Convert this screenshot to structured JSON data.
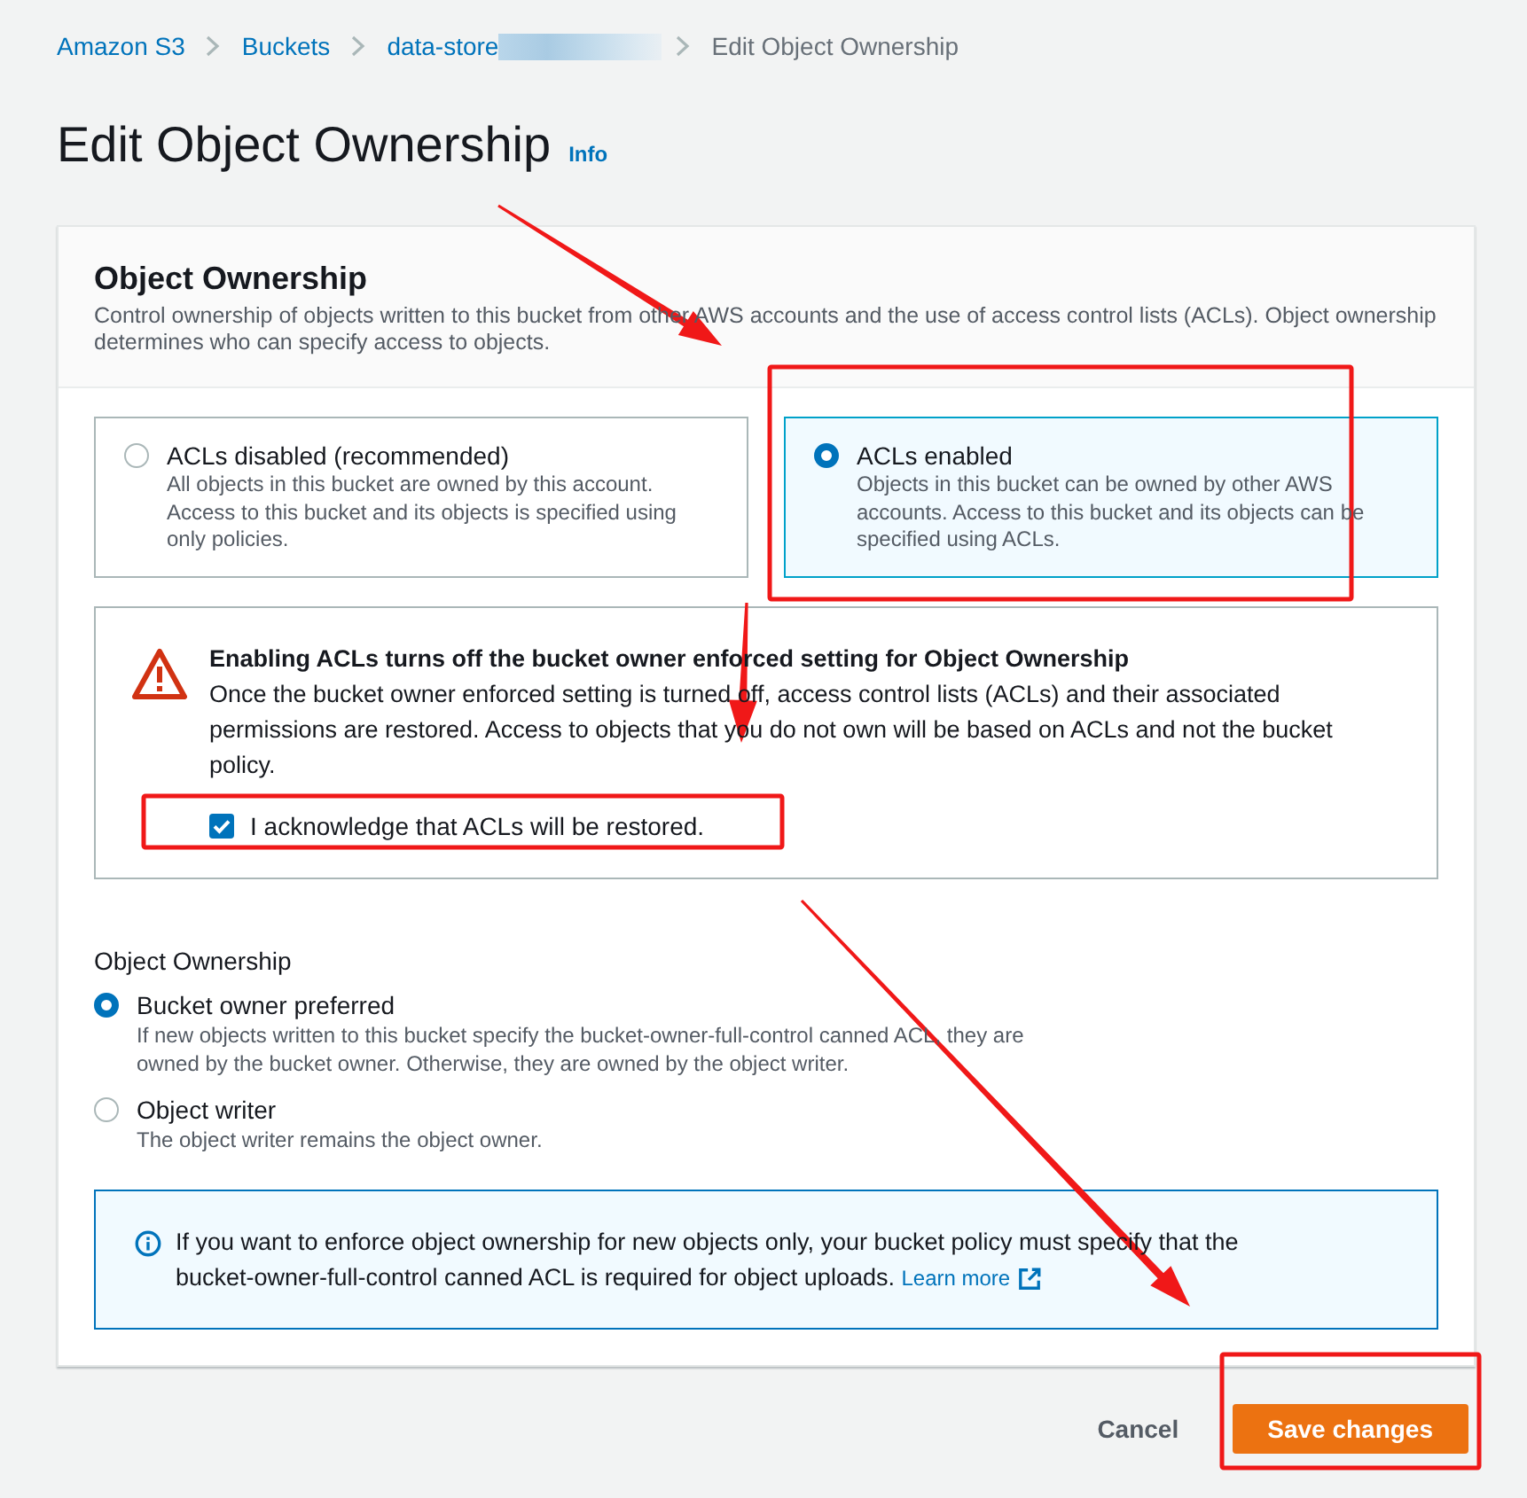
{
  "breadcrumb": [
    {
      "label": "Amazon S3",
      "kind": "link",
      "redacted": false
    },
    {
      "label": "Buckets",
      "kind": "link",
      "redacted": false
    },
    {
      "label": "data-store",
      "kind": "link",
      "redacted": true
    },
    {
      "label": "Edit Object Ownership",
      "kind": "current",
      "redacted": false
    }
  ],
  "page_title": "Edit Object Ownership",
  "info_link": "Info",
  "panel": {
    "title": "Object Ownership",
    "description": "Control ownership of objects written to this bucket from other AWS accounts and the use of access control lists (ACLs). Object ownership determines who can specify access to objects.",
    "tiles": [
      {
        "title": "ACLs disabled (recommended)",
        "description": "All objects in this bucket are owned by this account. Access to this bucket and its objects is specified using only policies.",
        "selected": false
      },
      {
        "title": "ACLs enabled",
        "description": "Objects in this bucket can be owned by other AWS accounts. Access to this bucket and its objects can be specified using ACLs.",
        "selected": true
      }
    ],
    "alert": {
      "kind": "warning",
      "title": "Enabling ACLs turns off the bucket owner enforced setting for Object Ownership",
      "body": "Once the bucket owner enforced setting is turned off, access control lists (ACLs) and their associated permissions are restored. Access to objects that you do not own will be based on ACLs and not the bucket policy.",
      "checkbox": {
        "label": "I acknowledge that ACLs will be restored.",
        "checked": true
      }
    },
    "ownership": {
      "label": "Object Ownership",
      "options": [
        {
          "title": "Bucket owner preferred",
          "description": "If new objects written to this bucket specify the bucket-owner-full-control canned ACL, they are owned by the bucket owner. Otherwise, they are owned by the object writer.",
          "selected": true
        },
        {
          "title": "Object writer",
          "description": "The object writer remains the object owner.",
          "selected": false
        }
      ]
    },
    "info": {
      "kind": "info",
      "text": "If you want to enforce object ownership for new objects only, your bucket policy must specify that the bucket-owner-full-control canned ACL is required for object uploads.",
      "link": "Learn more"
    }
  },
  "buttons": [
    {
      "label": "Cancel",
      "kind": "link"
    },
    {
      "label": "Save changes",
      "kind": "primary"
    }
  ],
  "annotations": [
    {
      "kind": "arrow"
    },
    {
      "kind": "box"
    },
    {
      "kind": "arrow"
    },
    {
      "kind": "box"
    },
    {
      "kind": "arrow"
    },
    {
      "kind": "box"
    }
  ]
}
